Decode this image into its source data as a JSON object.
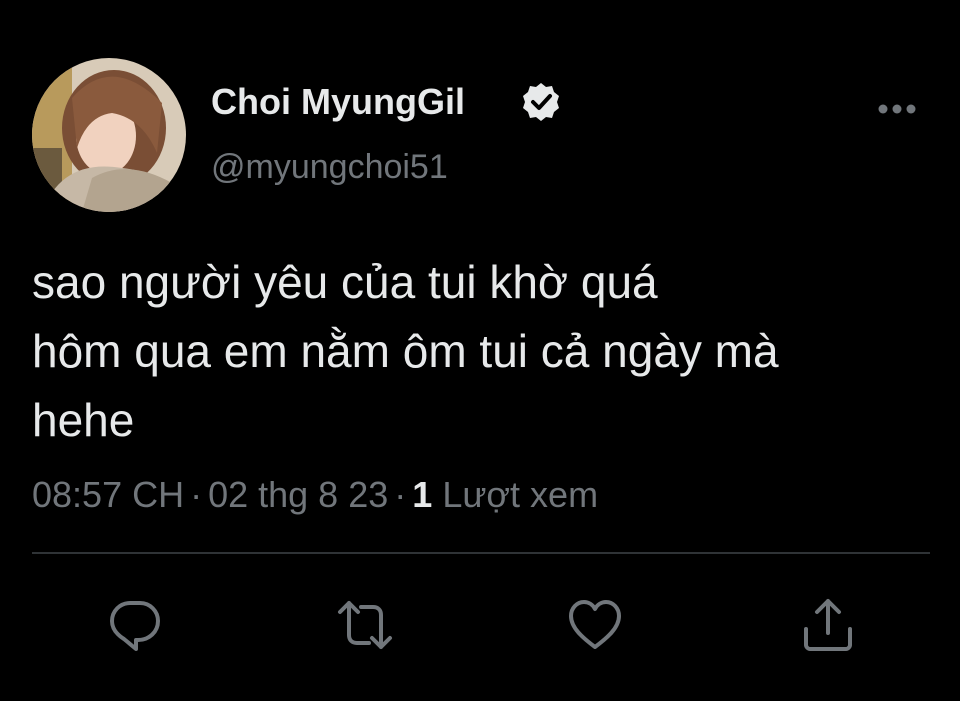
{
  "tweet": {
    "author": {
      "display_name": "Choi MyungGil",
      "handle": "@myungchoi51",
      "verified": true
    },
    "text_lines": [
      "sao người yêu của tui khờ quá",
      "hôm qua em nằm ôm tui cả ngày mà",
      "hehe"
    ],
    "time": "08:57 CH",
    "date": "02 thg 8 23",
    "separator": "·",
    "views_count": "1",
    "views_label": "Lượt xem"
  },
  "icons": {
    "more": "more-options-icon",
    "verified": "verified-badge-icon",
    "reply": "reply-icon",
    "retweet": "retweet-icon",
    "like": "like-icon",
    "share": "share-icon"
  },
  "colors": {
    "background": "#000000",
    "text_primary": "#e7e9ea",
    "text_secondary": "#71767b",
    "divider": "#2f3336"
  }
}
